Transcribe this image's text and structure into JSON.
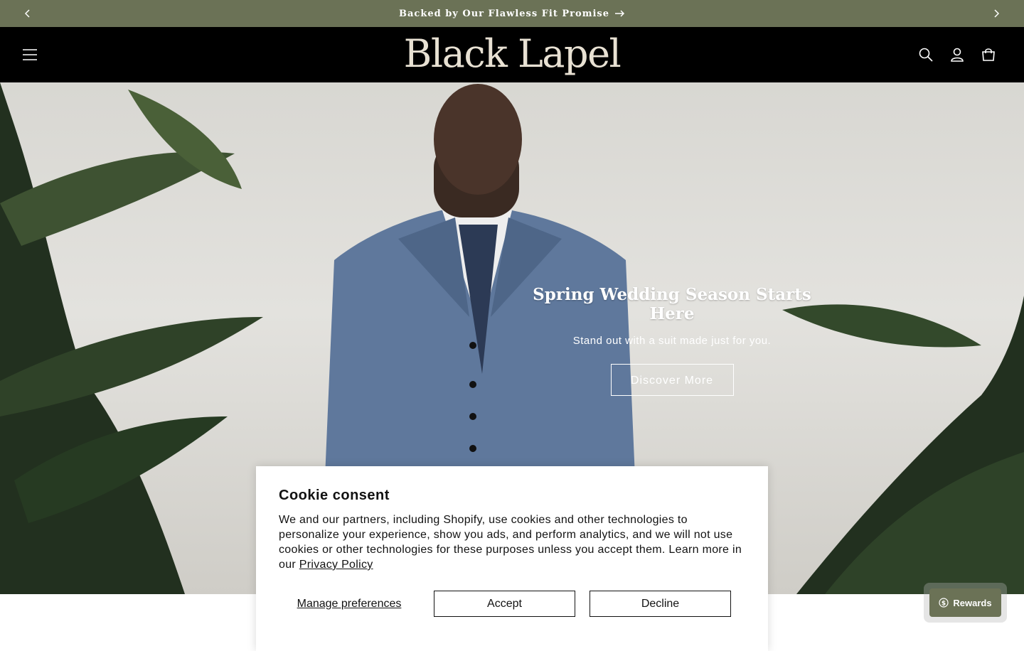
{
  "announcement": {
    "message": "Backed by Our Flawless Fit Promise"
  },
  "header": {
    "logo": "Black Lapel"
  },
  "hero": {
    "title": "Spring Wedding Season Starts Here",
    "subtitle": "Stand out with a suit made just for you.",
    "button": "Discover More"
  },
  "cookie": {
    "title": "Cookie consent",
    "body": "We and our partners, including Shopify, use cookies and other technologies to personalize your experience, show you ads, and perform analytics, and we will not use cookies or other technologies for these purposes unless you accept them. Learn more in our",
    "policy_link": "Privacy Policy",
    "manage": "Manage preferences",
    "accept": "Accept",
    "decline": "Decline"
  },
  "rewards": {
    "label": "Rewards"
  },
  "colors": {
    "accent": "#6b7256",
    "header_bg": "#000000",
    "logo": "#e8e1d3"
  },
  "icons": [
    "chevron-left-icon",
    "chevron-right-icon",
    "arrow-right-icon",
    "hamburger-menu-icon",
    "search-icon",
    "account-icon",
    "cart-icon",
    "rewards-icon"
  ]
}
